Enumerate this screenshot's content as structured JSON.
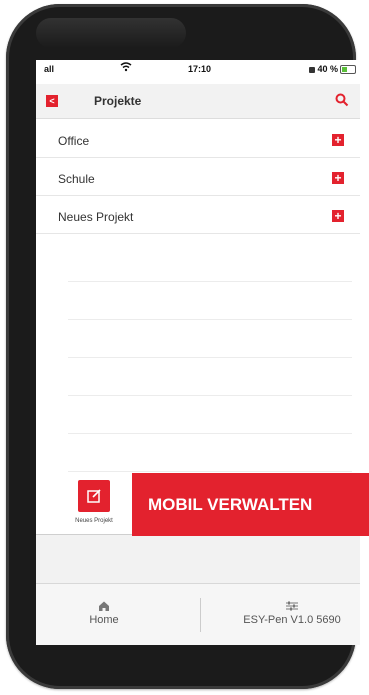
{
  "status_bar": {
    "signal": "all",
    "time": "17:10",
    "battery": "40 %"
  },
  "header": {
    "title": "Projekte",
    "back_label": "<"
  },
  "projects": [
    {
      "name": "Office"
    },
    {
      "name": "Schule"
    },
    {
      "name": "Neues Projekt"
    }
  ],
  "new_project": {
    "label": "Neues Projekt"
  },
  "banner": {
    "text": "MOBIL VERWALTEN"
  },
  "tab_bar": {
    "home_label": "Home",
    "device_label": "ESY-Pen V1.0 5690"
  },
  "colors": {
    "accent": "#e3222e",
    "background": "#ffffff",
    "phone_frame": "#1b1b1b"
  }
}
